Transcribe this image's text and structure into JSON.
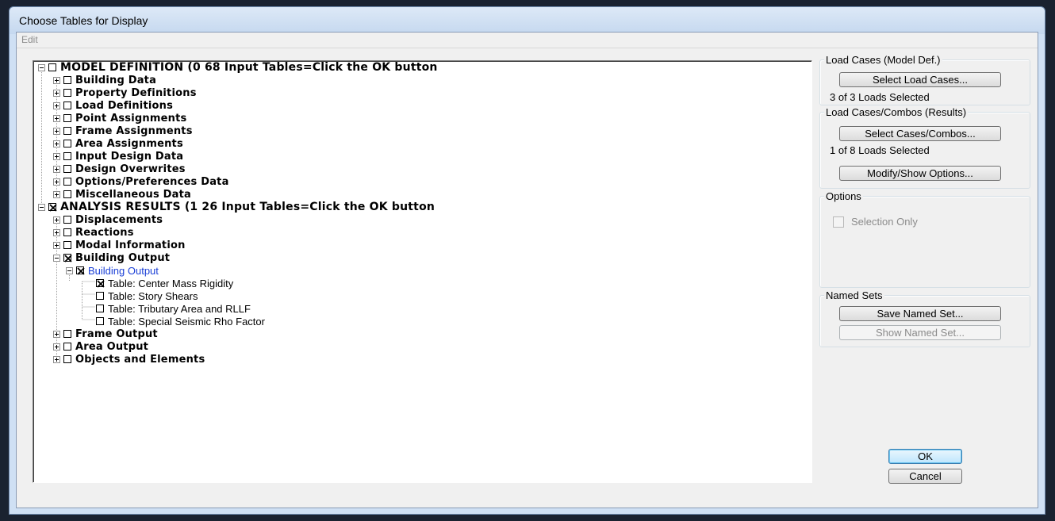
{
  "window": {
    "title": "Choose Tables for Display"
  },
  "menu": {
    "edit": "Edit"
  },
  "tree": {
    "model_definition": "MODEL DEFINITION  (0  68 Input Tables=Click the OK button",
    "model_children": [
      "Building Data",
      "Property Definitions",
      "Load Definitions",
      "Point Assignments",
      "Frame Assignments",
      "Area Assignments",
      "Input Design Data",
      "Design Overwrites",
      "Options/Preferences Data",
      "Miscellaneous Data"
    ],
    "analysis_results": "ANALYSIS RESULTS  (1  26 Input Tables=Click the OK button",
    "analysis_children": {
      "displacements": "Displacements",
      "reactions": "Reactions",
      "modal_information": "Modal Information",
      "building_output": "Building Output",
      "building_output_sub": "Building Output",
      "tables": [
        "Table:  Center Mass Rigidity",
        "Table:  Story Shears",
        "Table:  Tributary Area and RLLF",
        "Table:  Special Seismic Rho Factor"
      ],
      "frame_output": "Frame Output",
      "area_output": "Area Output",
      "objects_and_elements": "Objects and Elements"
    }
  },
  "load_cases_model": {
    "title": "Load Cases (Model Def.)",
    "button": "Select Load Cases...",
    "status": "3  of  3  Loads Selected"
  },
  "load_cases_results": {
    "title": "Load Cases/Combos (Results)",
    "button": "Select Cases/Combos...",
    "status": "1  of  8  Loads Selected",
    "options_button": "Modify/Show Options..."
  },
  "options": {
    "title": "Options",
    "selection_only": "Selection Only"
  },
  "named_sets": {
    "title": "Named Sets",
    "save": "Save Named Set...",
    "show": "Show Named Set..."
  },
  "dialog_buttons": {
    "ok": "OK",
    "cancel": "Cancel"
  }
}
